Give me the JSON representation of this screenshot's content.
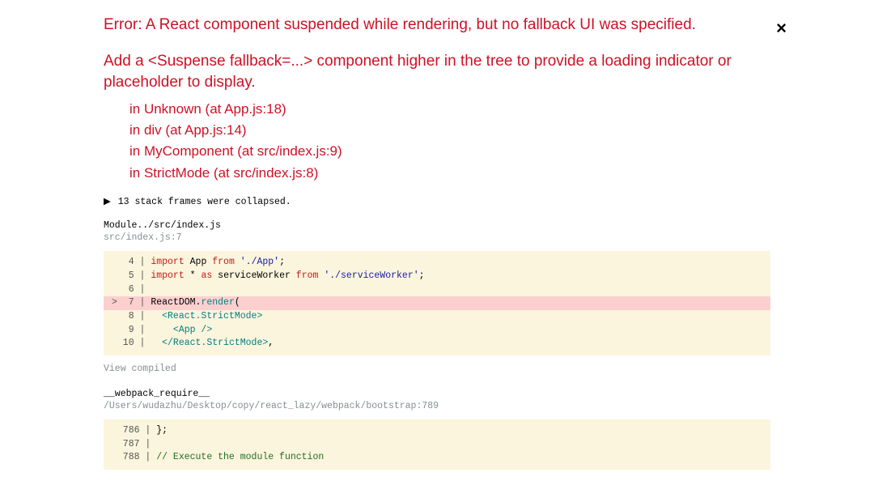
{
  "error": {
    "title": "Error: A React component suspended while rendering, but no fallback UI was specified.",
    "hint": "Add a <Suspense fallback=...> component higher in the tree to provide a loading indicator or placeholder to display.",
    "trace": [
      "in Unknown (at App.js:18)",
      "in div (at App.js:14)",
      "in MyComponent (at src/index.js:9)",
      "in StrictMode (at src/index.js:8)"
    ]
  },
  "collapsed_frames_label": "13 stack frames were collapsed.",
  "frame1": {
    "heading": "Module../src/index.js",
    "location": "src/index.js:7",
    "code": [
      {
        "n": 4,
        "hl": false,
        "tokens": [
          [
            "kw",
            "import"
          ],
          [
            "id",
            " App "
          ],
          [
            "kw",
            "from"
          ],
          [
            "id",
            " "
          ],
          [
            "str",
            "'./App'"
          ],
          [
            "id",
            ";"
          ]
        ]
      },
      {
        "n": 5,
        "hl": false,
        "tokens": [
          [
            "kw",
            "import"
          ],
          [
            "id",
            " * "
          ],
          [
            "kw",
            "as"
          ],
          [
            "id",
            " serviceWorker "
          ],
          [
            "kw",
            "from"
          ],
          [
            "id",
            " "
          ],
          [
            "str",
            "'./serviceWorker'"
          ],
          [
            "id",
            ";"
          ]
        ]
      },
      {
        "n": 6,
        "hl": false,
        "tokens": []
      },
      {
        "n": 7,
        "hl": true,
        "tokens": [
          [
            "id",
            "ReactDOM"
          ],
          [
            "id",
            "."
          ],
          [
            "jsx",
            "render"
          ],
          [
            "id",
            "("
          ]
        ]
      },
      {
        "n": 8,
        "hl": false,
        "tokens": [
          [
            "id",
            "  "
          ],
          [
            "jsx",
            "<React.StrictMode>"
          ]
        ]
      },
      {
        "n": 9,
        "hl": false,
        "tokens": [
          [
            "id",
            "    "
          ],
          [
            "jsx",
            "<App />"
          ]
        ]
      },
      {
        "n": 10,
        "hl": false,
        "tokens": [
          [
            "id",
            "  "
          ],
          [
            "jsx",
            "</React.StrictMode>"
          ],
          [
            "id",
            ","
          ]
        ]
      }
    ],
    "view_compiled_label": "View compiled"
  },
  "frame2": {
    "heading": "__webpack_require__",
    "location": "/Users/wudazhu/Desktop/copy/react_lazy/webpack/bootstrap:789",
    "code": [
      {
        "n": 786,
        "hl": false,
        "tokens": [
          [
            "id",
            "};"
          ]
        ]
      },
      {
        "n": 787,
        "hl": false,
        "tokens": []
      },
      {
        "n": 788,
        "hl": false,
        "tokens": [
          [
            "cm",
            "// Execute the module function"
          ]
        ]
      }
    ]
  },
  "close_symbol": "×"
}
